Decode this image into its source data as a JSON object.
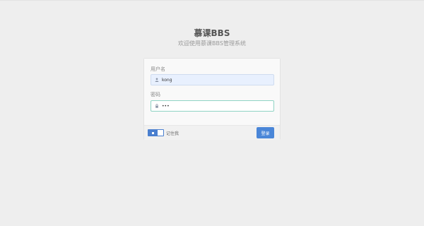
{
  "header": {
    "title": "慕课BBS",
    "subtitle": "欢迎使用慕课BBS管理系统"
  },
  "form": {
    "username_label": "用户名",
    "username_value": "kong",
    "username_icon": "user-icon",
    "password_label": "密码",
    "password_value": "•••",
    "password_icon": "lock-icon",
    "remember_label": "记住我",
    "remember_checked": true,
    "login_label": "登录"
  },
  "colors": {
    "accent": "#4a86d8",
    "username_bg": "#e8f0fe",
    "password_border": "#8fd3c4"
  }
}
